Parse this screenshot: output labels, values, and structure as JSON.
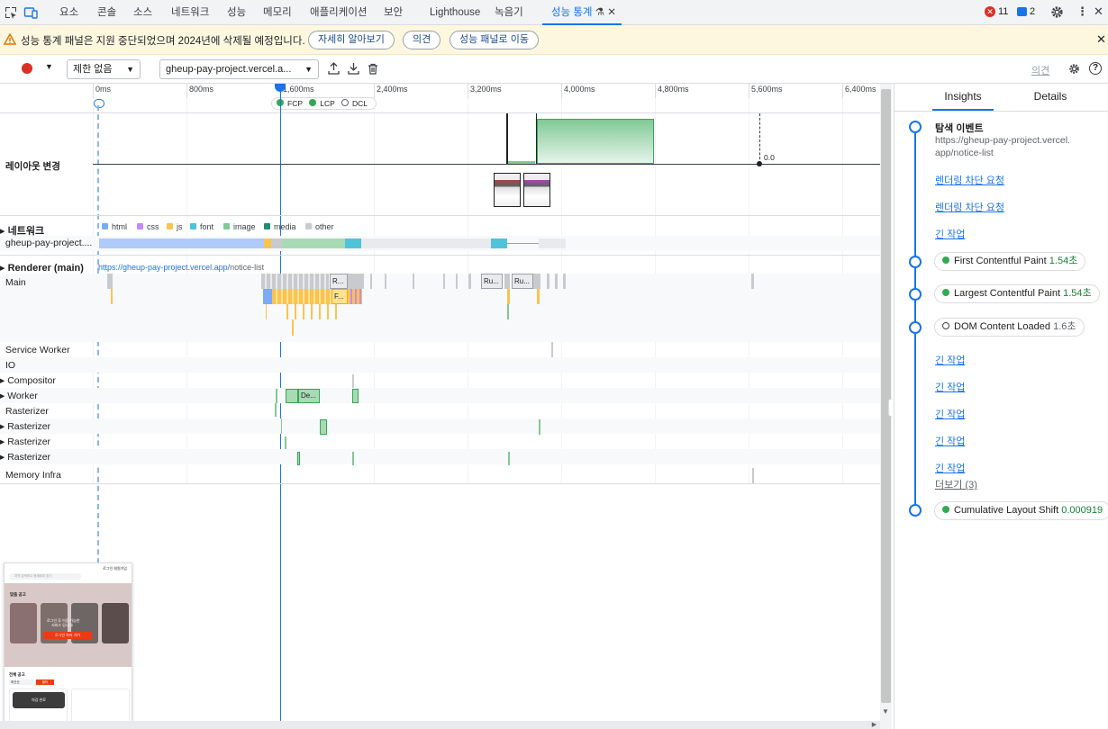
{
  "tabs": [
    "요소",
    "콘솔",
    "소스",
    "네트워크",
    "성능",
    "메모리",
    "애플리케이션",
    "보안",
    "Lighthouse",
    "녹음기",
    "성능 통계"
  ],
  "active_tab": "성능 통계",
  "status": {
    "errors": "11",
    "messages": "2"
  },
  "warning": {
    "text": "성능 통계 패널은 지원 중단되었으며 2024년에 삭제될 예정입니다.",
    "learn_more": "자세히 알아보기",
    "feedback": "의견",
    "goto_perf": "성능 패널로 이동"
  },
  "toolbar": {
    "throttle": "제한 없음",
    "url_select": "gheup-pay-project.vercel.a...",
    "feedback_link": "의견"
  },
  "ruler": {
    "ticks": [
      "0ms",
      "800ms",
      "1,600ms",
      "2,400ms",
      "3,200ms",
      "4,000ms",
      "4,800ms",
      "5,600ms",
      "6,400ms"
    ],
    "markers": [
      "FCP",
      "LCP",
      "DCL"
    ]
  },
  "tracks": {
    "layout_shift": "레이아웃 변경",
    "cls_value": "0.0",
    "network": "네트워크",
    "network_row": "gheup-pay-project....",
    "renderer": "Renderer (main)",
    "renderer_url_main": "https://gheup-pay-project.vercel.app/",
    "renderer_url_path": "notice-list",
    "main": "Main",
    "service_worker": "Service Worker",
    "io": "IO",
    "compositor": "Compositor",
    "worker": "Worker",
    "rasterizer": "Rasterizer",
    "memory_infra": "Memory Infra",
    "task_labels": [
      "R...",
      "F...",
      "Ru...",
      "Ru...",
      "De..."
    ]
  },
  "legend": [
    {
      "label": "html",
      "color": "#7baaf7"
    },
    {
      "label": "css",
      "color": "#c58af9"
    },
    {
      "label": "js",
      "color": "#f9c44e"
    },
    {
      "label": "font",
      "color": "#4fc3d9"
    },
    {
      "label": "image",
      "color": "#81c995"
    },
    {
      "label": "media",
      "color": "#1e8e6e"
    },
    {
      "label": "other",
      "color": "#c8cace"
    }
  ],
  "screenshot": {
    "header_links": [
      "로그인",
      "회원가입"
    ],
    "search_placeholder": "지역 검색하고 현재위치 찾기",
    "section_title": "맞춤 공고",
    "banner_line1": "로그인 후 이용 가능한",
    "banner_line2": "서비스 입니다!",
    "banner_button": "로그인 하러 가기",
    "all_posts": "전체 공고",
    "filter_1": "최신순",
    "filter_2": "필터",
    "card_title": "마감 완료"
  },
  "right_panel": {
    "tab_insights": "Insights",
    "tab_details": "Details",
    "nav_event_title": "탐색 이벤트",
    "nav_event_url": "https://gheup-pay-project.vercel.app/notice-list",
    "render_blocking_1": "렌더링 차단 요청",
    "render_blocking_2": "렌더링 차단 요청",
    "long_task_1": "긴 작업",
    "fcp_label": "First Contentful Paint",
    "fcp_value": "1.54초",
    "lcp_label": "Largest Contentful Paint",
    "lcp_value": "1.54초",
    "dcl_label": "DOM Content Loaded",
    "dcl_value": "1.6초",
    "long_task_2": "긴 작업",
    "long_task_3": "긴 작업",
    "long_task_4": "긴 작업",
    "long_task_5": "긴 작업",
    "long_task_6": "긴 작업",
    "more": "더보기 (3)",
    "cls_label": "Cumulative Layout Shift",
    "cls_value": "0.000919"
  }
}
